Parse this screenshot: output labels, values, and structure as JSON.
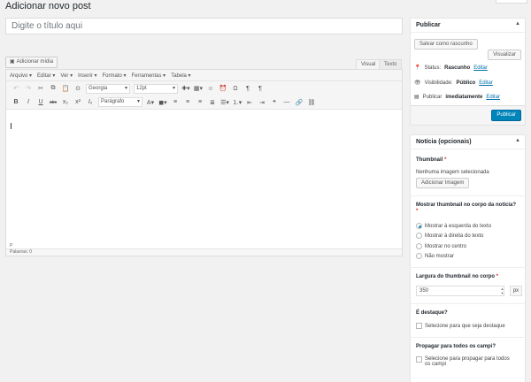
{
  "page": {
    "title": "Adicionar novo post"
  },
  "title_field": {
    "placeholder": "Digite o título aqui"
  },
  "editor": {
    "add_media": "Adicionar mídia",
    "tabs": {
      "visual": "Visual",
      "text": "Texto"
    },
    "menu": [
      "Arquivo",
      "Editar",
      "Ver",
      "Inserir",
      "Formato",
      "Ferramentas",
      "Tabela"
    ],
    "font_family": "Georgia",
    "font_size": "12pt",
    "block_format": "Parágrafo",
    "path": "P",
    "word_count": "Palavras: 0"
  },
  "publish": {
    "title": "Publicar",
    "save_draft": "Salvar como rascunho",
    "preview": "Visualizar",
    "status_label": "Status:",
    "status_value": "Rascunho",
    "visibility_label": "Visibilidade:",
    "visibility_value": "Público",
    "schedule_label": "Publicar",
    "schedule_value": "imediatamente",
    "edit": "Editar",
    "publish_button": "Publicar"
  },
  "noticia": {
    "title": "Notícia (opcionais)",
    "thumbnail_label": "Thumbnail",
    "no_image": "Nenhuma imagem selecionada",
    "add_image": "Adicionar Imagem",
    "show_thumb_label": "Mostrar thumbnail no corpo da notícia?",
    "options": [
      "Mostrar à esquerda do texto",
      "Mostrar à direita do texto",
      "Mostrar no centro",
      "Não mostrar"
    ],
    "width_label": "Largura do thumbnail no corpo",
    "width_value": "350",
    "width_unit": "px",
    "highlight_label": "É destaque?",
    "highlight_check": "Selecione para que seja destaque",
    "propagate_label": "Propagar para todos os campi?",
    "propagate_check_1": "Selecione para propagar para todos",
    "propagate_check_2": "os campi",
    "required_mark": "*"
  }
}
